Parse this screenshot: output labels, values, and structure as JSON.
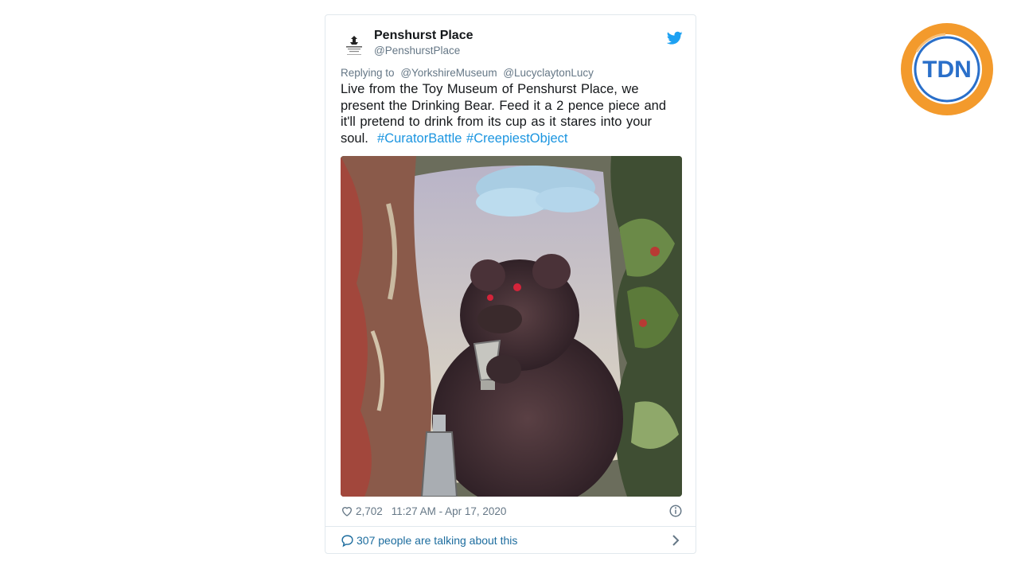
{
  "tweet": {
    "author_name": "Penshurst Place",
    "author_handle": "@PenshurstPlace",
    "avatar_icon": "penshurst-crest-icon",
    "avatar_text": "PENSHURST PLACE & GARDENS",
    "bird_icon": "twitter-bird-icon",
    "reply_prefix": "Replying to",
    "reply_to": [
      "@YorkshireMuseum",
      "@LucyclaytonLucy"
    ],
    "text_main": "Live from the Toy Museum of Penshurst Place, we present the Drinking Bear. Feed it a 2 pence piece and it'll pretend to drink from its cup as it stares into your soul.",
    "hashtags": [
      "#CuratorBattle",
      "#CreepiestObject"
    ],
    "image_icon": "drinking-bear-photo",
    "likes": "2,702",
    "timestamp": "11:27 AM - Apr 17, 2020",
    "conversation_text": "307 people are talking about this"
  },
  "watermark": {
    "logo_text": "TDN",
    "ring_color": "#f39a2c",
    "text_color": "#2a6fc9"
  },
  "colors": {
    "link": "#1b95e0",
    "muted": "#657786",
    "conversation": "#1c6c9e",
    "text": "#14171a"
  }
}
